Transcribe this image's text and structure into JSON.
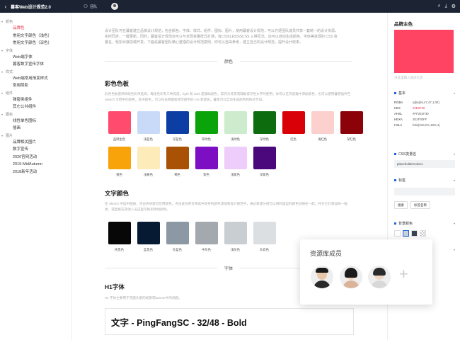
{
  "app": {
    "title": "暮客Web设计规范2.0",
    "team_label": "团队",
    "back_icon": "chevron-left-icon",
    "team_icon": "team-icon",
    "right_icons": [
      "search-icon",
      "download-icon",
      "settings-icon"
    ]
  },
  "sidebar": {
    "groups": [
      {
        "label": "颜色",
        "items": [
          {
            "label": "品牌色",
            "active": true
          },
          {
            "label": "常用文字颜色（浅色）"
          },
          {
            "label": "常用文字颜色（深色）"
          }
        ]
      },
      {
        "label": "字体",
        "items": [
          {
            "label": "Web端字体"
          },
          {
            "label": "暮客数字宣传字体"
          }
        ]
      },
      {
        "label": "样式",
        "items": [
          {
            "label": "Web端常用渐变样式"
          },
          {
            "label": "常用阴影"
          }
        ]
      },
      {
        "label": "组件",
        "items": [
          {
            "label": "弹窗类组件"
          },
          {
            "label": "其它公共组件"
          }
        ]
      },
      {
        "label": "图标",
        "items": [
          {
            "label": "线性单色图标"
          },
          {
            "label": "插画"
          }
        ]
      },
      {
        "label": "图片",
        "items": [
          {
            "label": "品牌相关图片"
          },
          {
            "label": "数字宣传"
          },
          {
            "label": "2020官网活动"
          },
          {
            "label": "2019-MidAutumn"
          },
          {
            "label": "2018新年活动"
          }
        ]
      }
    ]
  },
  "main": {
    "intro": "设计团队可在暮客建立品牌设计规范，包含颜色、字体、样式、组件、图标、图片，使用暮客设计规范，可以方便团队成员共享一套统一的设计资源，实时同步，一键更新。同时，暮客设计规范还可以与全局变量样式打通，有CSS\\LESS\\SCSS 三种写法。还可以自动生成颜色、字体等资源的 CSS 变量名，轻松对接前端开发。下面是暮客团队精心整理的设计规范案例，你可以自由参考，建立自己的设计规范，提升设计效率。",
    "section_color": "颜色",
    "palette": {
      "title": "彩色色板",
      "desc": "彩色色板提供四组色彩供选择，每组色彩有三种亮度，light 和 dark 是辅助颜色，常作为背景或辅助提示性文字时使用。你可以在浏览器中添加颜色，也可以使用暮客插件在 Sketch 文档中的颜色，选中颜色，可以在右侧面板修改颜色的 css 变量名。暮客可以自动生成颜色和样式代码。",
      "row1": [
        {
          "label": "品牌主色",
          "color": "#ff4b6e"
        },
        {
          "label": "浅蓝色",
          "color": "#c9daf9"
        },
        {
          "label": "深蓝色",
          "color": "#0c3ea3"
        },
        {
          "label": "草绿色",
          "color": "#0aa30a"
        },
        {
          "label": "浅绿色",
          "color": "#cdebcd"
        },
        {
          "label": "深绿色",
          "color": "#0d6d0e"
        },
        {
          "label": "红色",
          "color": "#d90008"
        },
        {
          "label": "浅红色",
          "color": "#fbd0cd"
        },
        {
          "label": "深红色",
          "color": "#8b0208"
        }
      ],
      "row2": [
        {
          "label": "橙色",
          "color": "#f8a30a"
        },
        {
          "label": "浅黄色",
          "color": "#fdebb9"
        },
        {
          "label": "褐色",
          "color": "#a95206"
        },
        {
          "label": "紫色",
          "color": "#7d0ec3"
        },
        {
          "label": "浅紫色",
          "color": "#efcdfb"
        },
        {
          "label": "深紫色",
          "color": "#4a087c"
        }
      ]
    },
    "text_colors": {
      "title": "文字颜色",
      "desc": "在 Sketch 中选中图层，点击色块提可应用颜色。点击发号带可将选中组件的颜色添加到设计规范中，通过新建分组可以将同类型的颜色归纳在一起。并为它们添加统一描述，或直接在其他人员这里可拖到添加颜色。",
      "row": [
        {
          "label": "纯黑色",
          "color": "#070707"
        },
        {
          "label": "蓝黑色",
          "color": "#071a33"
        },
        {
          "label": "灰蓝色",
          "color": "#8c98a3"
        },
        {
          "label": "中灰色",
          "color": "#a4a9af"
        },
        {
          "label": "浅灰色",
          "color": "#c9ced3"
        },
        {
          "label": "灰白色",
          "color": "#dcdfe2"
        }
      ]
    },
    "section_font": "字体",
    "h1_font": {
      "title": "H1字体",
      "desc": "H1 字体主要用于页面头部的标题或banner中的标题。",
      "sample": "文字 - PingFangSC - 32/48 - Bold"
    }
  },
  "rpanel": {
    "title": "品牌主色",
    "color": "#ff4362",
    "placeholder": "点这里输入描述信息",
    "base": {
      "label": "基本",
      "rows": [
        {
          "k": "RGBA",
          "v": "rgba(46,47,47,1.00)",
          "red": false
        },
        {
          "k": "HEX",
          "v": "#2E2F30",
          "red": true
        },
        {
          "k": "AHSL",
          "v": "#FF2E2F30",
          "red": false
        },
        {
          "k": "HEXA",
          "v": "2E2F30FF",
          "red": false
        },
        {
          "k": "HSLA",
          "v": "hsla(210,2%,18%,1)",
          "red": false
        }
      ]
    },
    "css_var": {
      "label": "CSS变量名",
      "value": "placeholderColor1"
    },
    "tags": {
      "label": "标签",
      "items": [
        "搜索",
        "标签名称"
      ]
    },
    "bg": {
      "label": "背景颜色",
      "colors": [
        "#ffffff",
        "#c9d1de",
        "#394356",
        "checker"
      ]
    },
    "bottom_label": "下载"
  },
  "popover": {
    "title": "资源库成员",
    "add_icon": "plus-icon"
  }
}
